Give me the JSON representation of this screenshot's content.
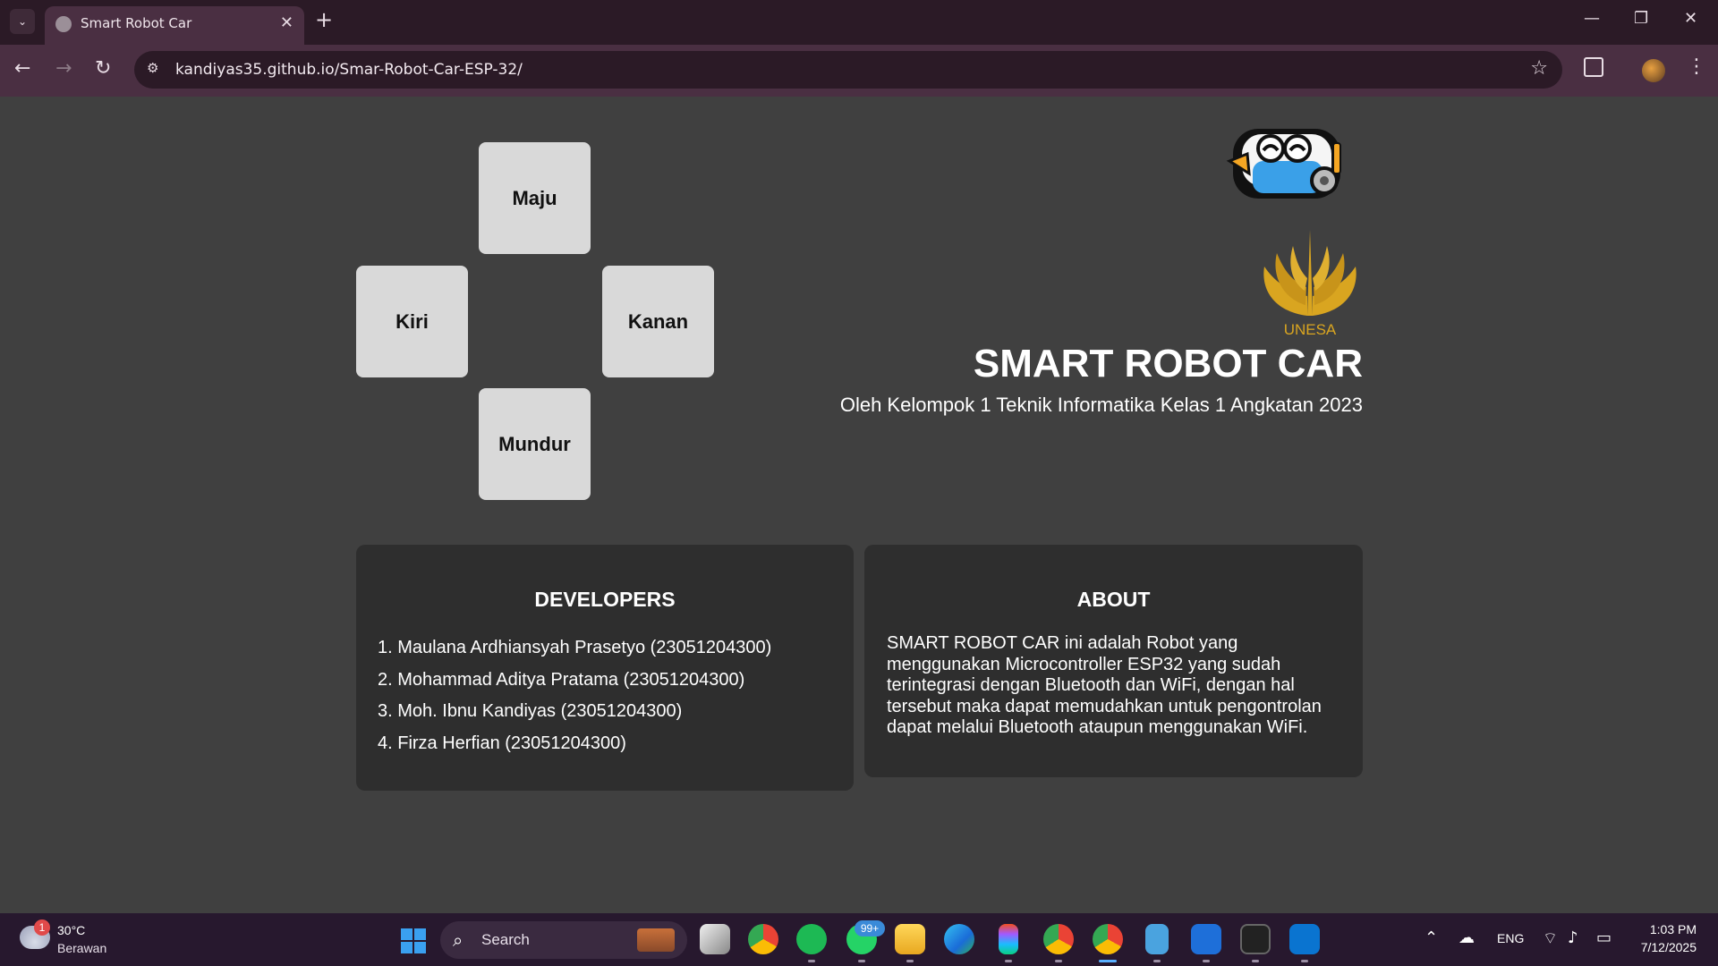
{
  "browser": {
    "tab_title": "Smart Robot Car",
    "url": "kandiyas35.github.io/Smar-Robot-Car-ESP-32/"
  },
  "controls": {
    "maju": "Maju",
    "kiri": "Kiri",
    "kanan": "Kanan",
    "mundur": "Mundur"
  },
  "hero": {
    "logo_text": "UNESA",
    "title": "SMART ROBOT CAR",
    "subtitle": "Oleh Kelompok 1 Teknik Informatika Kelas 1 Angkatan 2023"
  },
  "developers": {
    "title": "DEVELOPERS",
    "members": [
      "1. Maulana Ardhiansyah Prasetyo (23051204300)",
      "2. Mohammad Aditya Pratama (23051204300)",
      "3. Moh. Ibnu Kandiyas (23051204300)",
      "4. Firza Herfian (23051204300)"
    ]
  },
  "about": {
    "title": "ABOUT",
    "text": "SMART ROBOT CAR ini adalah Robot yang menggunakan Microcontroller ESP32 yang sudah terintegrasi dengan Bluetooth dan WiFi, dengan hal tersebut maka dapat memudahkan untuk pengontrolan dapat melalui Bluetooth ataupun menggunakan WiFi."
  },
  "taskbar": {
    "weather_badge": "1",
    "temperature": "30°C",
    "weather": "Berawan",
    "search_label": "Search",
    "whatsapp_badge": "99+",
    "language": "ENG",
    "time": "1:03 PM",
    "date": "7/12/2025"
  },
  "colors": {
    "page_bg": "#404040",
    "card_bg": "#2e2e2e",
    "button_bg": "#d9d9d9",
    "browser_frame": "#4a2f42"
  }
}
